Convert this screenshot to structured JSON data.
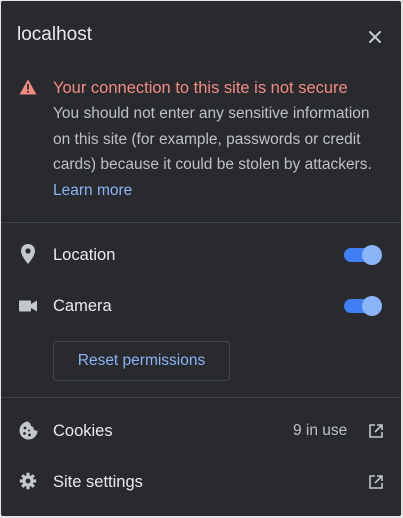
{
  "header": {
    "host": "localhost"
  },
  "warning": {
    "title": "Your connection to this site is not secure",
    "body": "You should not enter any sensitive information on this site (for example, passwords or credit cards) because it could be stolen by attackers.",
    "learn_more": "Learn more"
  },
  "permissions": [
    {
      "label": "Location",
      "icon": "location-pin-icon",
      "enabled": true
    },
    {
      "label": "Camera",
      "icon": "camera-icon",
      "enabled": true
    }
  ],
  "reset_label": "Reset permissions",
  "cookies": {
    "label": "Cookies",
    "count_text": "9 in use",
    "icon": "cookie-icon"
  },
  "site_settings": {
    "label": "Site settings",
    "icon": "gear-icon"
  },
  "colors": {
    "background": "#292a2d",
    "warning": "#f28b82",
    "accent": "#8ab4f8",
    "toggle_track": "#3f7ef4"
  }
}
